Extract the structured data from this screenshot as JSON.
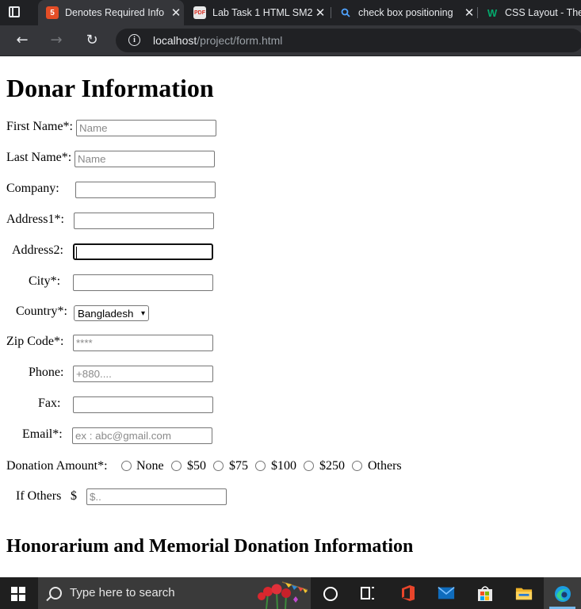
{
  "browser": {
    "tabs": [
      {
        "title": "Denotes Required Info",
        "active": true,
        "favicon": "html5-icon"
      },
      {
        "title": "Lab Task 1 HTML SM2",
        "active": false,
        "favicon": "pdf-icon"
      },
      {
        "title": "check box positioning",
        "active": false,
        "favicon": "search-icon"
      },
      {
        "title": "CSS Layout - The p",
        "active": false,
        "favicon": "w3schools-icon"
      }
    ],
    "url_host": "localhost",
    "url_path": "/project/form.html"
  },
  "form": {
    "title": "Donar Information",
    "first_name": {
      "label": "First Name*:",
      "placeholder": "Name",
      "value": ""
    },
    "last_name": {
      "label": "Last Name*:",
      "placeholder": "Name",
      "value": ""
    },
    "company": {
      "label": "Company:",
      "placeholder": "",
      "value": ""
    },
    "address1": {
      "label": "Address1*:",
      "placeholder": "",
      "value": ""
    },
    "address2": {
      "label": "Address2:",
      "placeholder": "",
      "value": ""
    },
    "city": {
      "label": "City*:",
      "placeholder": "",
      "value": ""
    },
    "country": {
      "label": "Country*:",
      "selected": "Bangladesh"
    },
    "zip": {
      "label": "Zip Code*:",
      "placeholder": "****",
      "value": ""
    },
    "phone": {
      "label": "Phone:",
      "placeholder": "+880....",
      "value": ""
    },
    "fax": {
      "label": "Fax:",
      "placeholder": "",
      "value": ""
    },
    "email": {
      "label": "Email*:",
      "placeholder": "ex : abc@gmail.com",
      "value": ""
    },
    "donation": {
      "label": "Donation Amount*:",
      "options": [
        "None",
        "$50",
        "$75",
        "$100",
        "$250",
        "Others"
      ]
    },
    "if_others": {
      "label": "If Others",
      "currency": "$",
      "placeholder": "$..",
      "value": ""
    },
    "section2_title": "Honorarium and Memorial Donation Information"
  },
  "taskbar": {
    "search_placeholder": "Type here to search"
  },
  "colors": {
    "tab_strip": "#202124",
    "toolbar": "#35363a",
    "taskbar": "#1f1f1f"
  }
}
